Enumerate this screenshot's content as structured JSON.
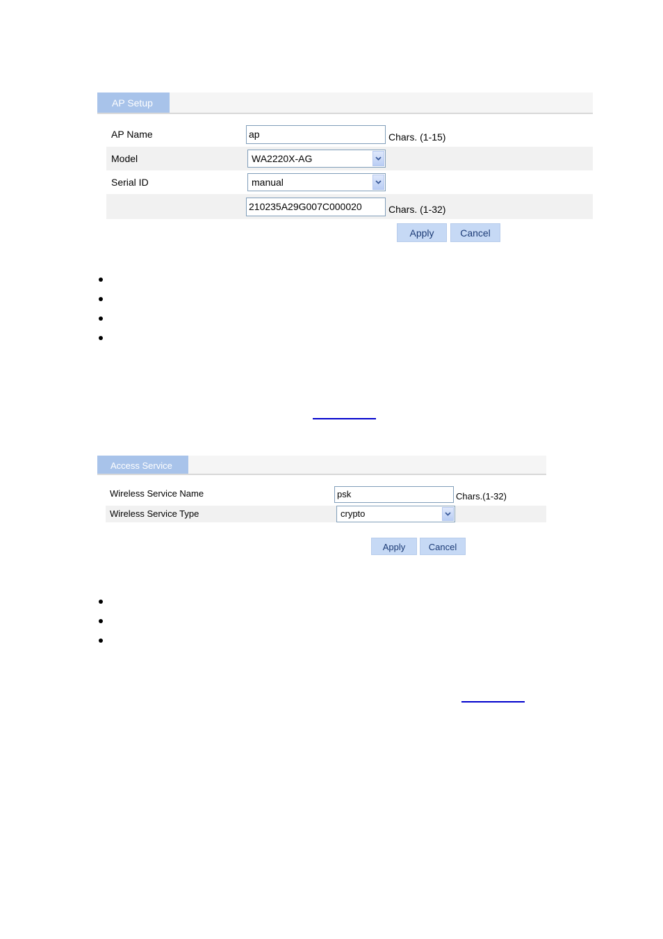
{
  "ap_setup": {
    "tab_label": "AP Setup",
    "fields": {
      "ap_name": {
        "label": "AP Name",
        "value": "ap",
        "hint": "Chars. (1-15)"
      },
      "model": {
        "label": "Model",
        "value": "WA2220X-AG"
      },
      "serial_id": {
        "label": "Serial ID",
        "value": "manual"
      },
      "serial_value": {
        "label": "",
        "value": "210235A29G007C000020",
        "hint": "Chars. (1-32)"
      }
    },
    "apply_label": "Apply",
    "cancel_label": "Cancel"
  },
  "access_service": {
    "tab_label": "Access Service",
    "fields": {
      "service_name": {
        "label": "Wireless Service Name",
        "value": "psk",
        "hint": "Chars.(1-32)"
      },
      "service_type": {
        "label": "Wireless Service Type",
        "value": "crypto"
      }
    },
    "apply_label": "Apply",
    "cancel_label": "Cancel"
  },
  "link_color": "#0000cc",
  "tab_color": "#a8c3ea",
  "button_color": "#c6d9f5"
}
